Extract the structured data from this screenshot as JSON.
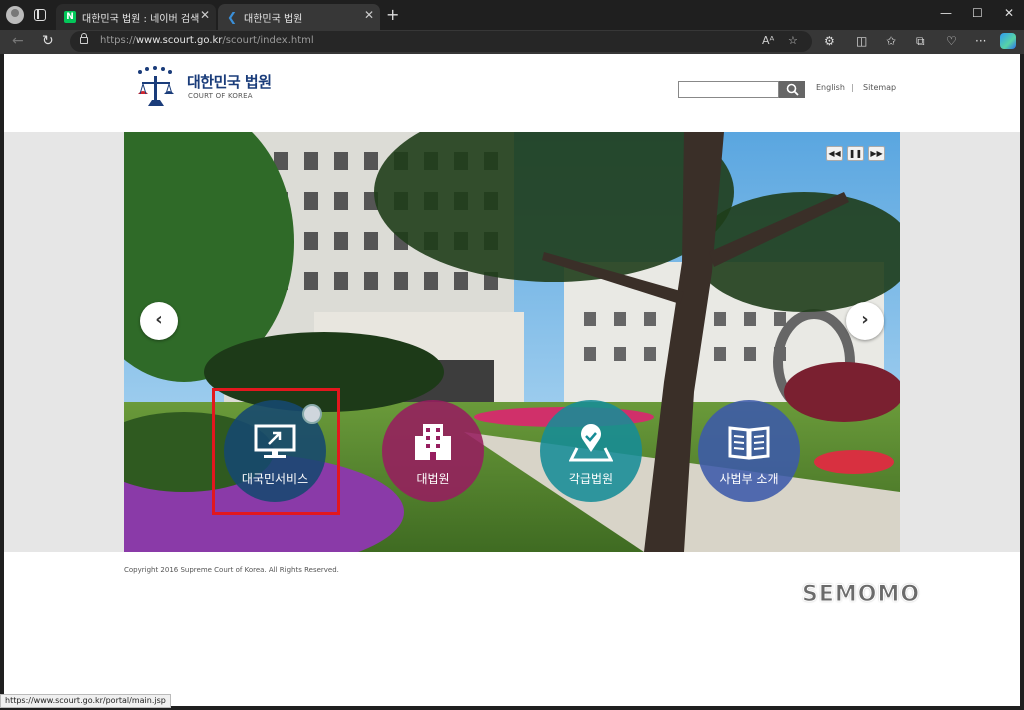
{
  "browser": {
    "tabs": [
      {
        "favicon": "N",
        "title": "대한민국 법원 : 네이버 검색",
        "close": "✕"
      },
      {
        "favicon": "❮",
        "title": "대한민국 법원",
        "close": "✕"
      }
    ],
    "new_tab": "+",
    "window_controls": {
      "minimize": "—",
      "maximize": "☐",
      "close": "✕"
    },
    "url_prefix": "https://",
    "url_host": "www.scourt.go.kr",
    "url_path": "/scourt/index.html",
    "status_url": "https://www.scourt.go.kr/portal/main.jsp"
  },
  "header": {
    "logo_title": "대한민국 법원",
    "logo_subtitle": "COURT OF KOREA",
    "search_value": "",
    "links": {
      "english": "English",
      "separator": "|",
      "sitemap": "Sitemap"
    }
  },
  "hero": {
    "controls": {
      "prev": "◀◀",
      "pause": "❚❚",
      "next": "▶▶"
    },
    "arrows": {
      "left": "‹",
      "right": "›"
    },
    "services": [
      {
        "label": "대국민서비스",
        "icon": "monitor-icon",
        "color": "#164870"
      },
      {
        "label": "대법원",
        "icon": "building-icon",
        "color": "#961e5f"
      },
      {
        "label": "각급법원",
        "icon": "map-pin-icon",
        "color": "#168c96"
      },
      {
        "label": "사법부 소개",
        "icon": "book-icon",
        "color": "#3c5aaa"
      }
    ]
  },
  "footer": {
    "copyright": "Copyright 2016 Supreme Court of Korea. All Rights Reserved."
  },
  "watermark": "SEMOMO"
}
